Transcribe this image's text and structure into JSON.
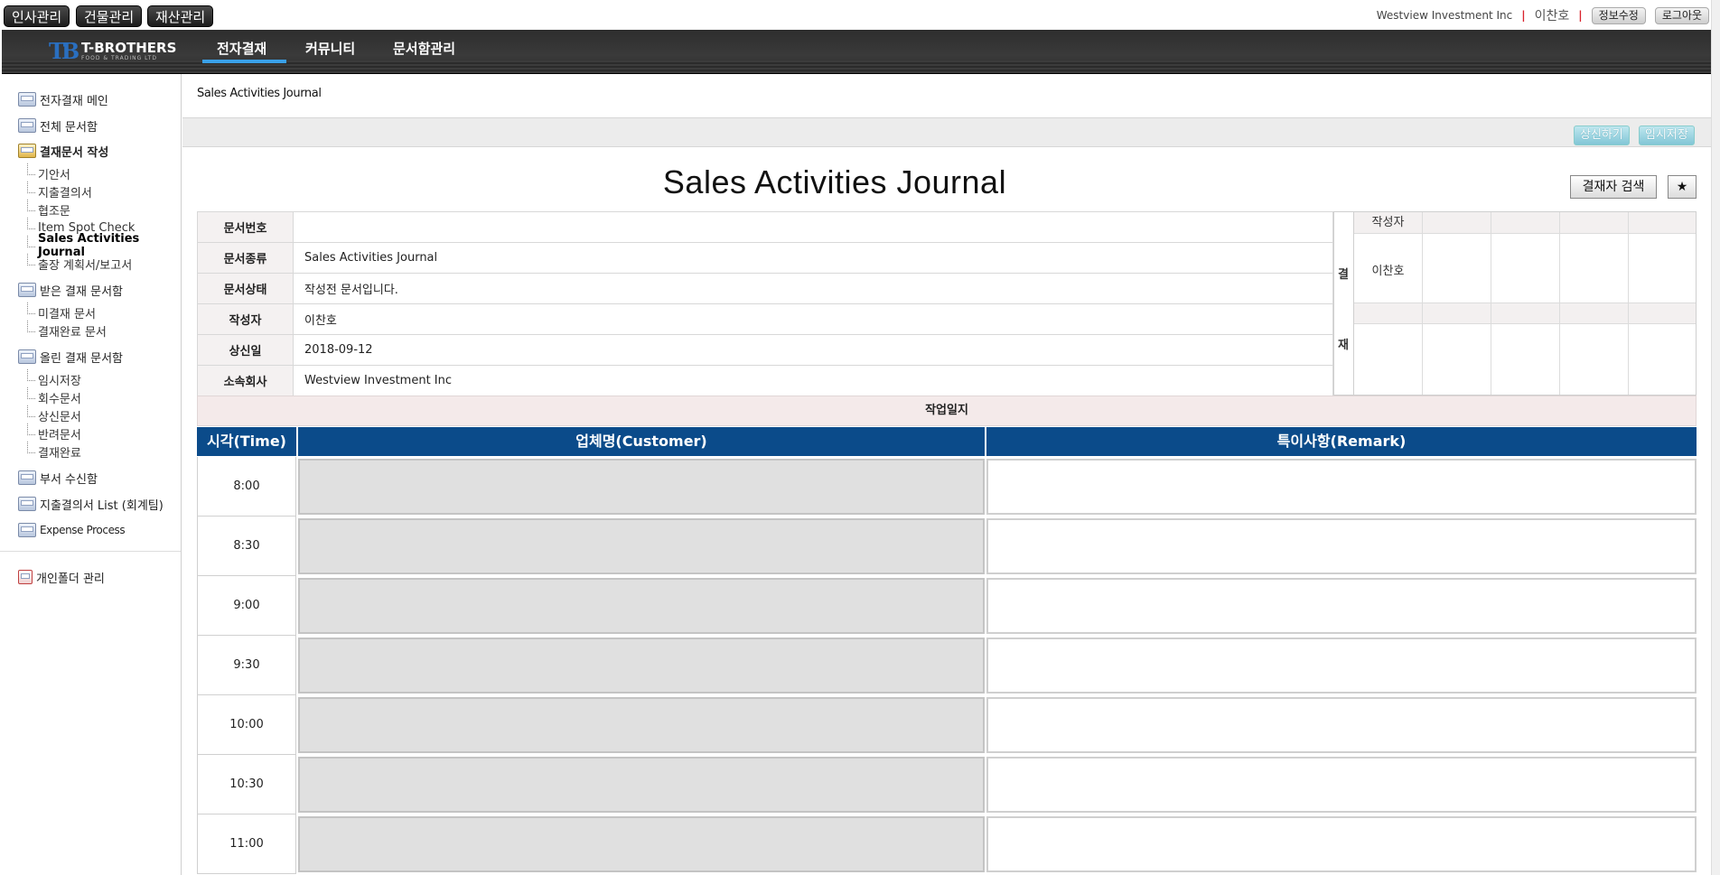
{
  "sysbar": {
    "hr": "인사관리",
    "building": "건물관리",
    "asset": "재산관리"
  },
  "topinfo": {
    "company": "Westview Investment Inc",
    "user": "이찬호",
    "edit_info": "정보수정",
    "logout": "로그아웃"
  },
  "brand": {
    "mark": "TB",
    "name": "T-BROTHERS",
    "sub": "FOOD & TRADING LTD"
  },
  "nav": {
    "tab1": "전자결재",
    "tab2": "커뮤니티",
    "tab3": "문서함관리"
  },
  "sidebar": {
    "main": "전자결재 메인",
    "all_docs": "전체 문서함",
    "compose": "결재문서 작성",
    "compose_items": [
      "기안서",
      "지출결의서",
      "협조문",
      "Item Spot Check",
      "Sales Activities Journal",
      "출장 계획서/보고서"
    ],
    "received": "받은 결재 문서함",
    "received_items": [
      "미결재 문서",
      "결재완료 문서"
    ],
    "sent": "올린 결재 문서함",
    "sent_items": [
      "임시저장",
      "회수문서",
      "상신문서",
      "반려문서",
      "결재완료"
    ],
    "dept_inbox": "부서 수신함",
    "expense_list": "지출결의서 List (회계팀)",
    "expense_process": "Expense Process",
    "personal_folder": "개인폴더 관리"
  },
  "main": {
    "breadcrumb": "Sales Activities Journal",
    "submit_btn": "상신하기",
    "save_btn": "임시저장",
    "title": "Sales Activities Journal",
    "search_approver_btn": "결재자 검색",
    "star_btn": "★"
  },
  "info": {
    "doc_no_label": "문서번호",
    "doc_no": "",
    "doc_type_label": "문서종류",
    "doc_type": "Sales Activities Journal",
    "doc_status_label": "문서상태",
    "doc_status": "작성전 문서입니다.",
    "writer_label": "작성자",
    "writer": "이찬호",
    "date_label": "상신일",
    "date": "2018-09-12",
    "company_label": "소속회사",
    "company": "Westview Investment Inc"
  },
  "approval": {
    "side_top": "결",
    "side_bottom": "재",
    "writer_header": "작성자",
    "writer_name": "이찬호"
  },
  "journal": {
    "section_title": "작업일지",
    "col_time": "시각(Time)",
    "col_customer": "업체명(Customer)",
    "col_remark": "특이사항(Remark)",
    "times": [
      "8:00",
      "8:30",
      "9:00",
      "9:30",
      "10:00",
      "10:30",
      "11:00"
    ]
  }
}
